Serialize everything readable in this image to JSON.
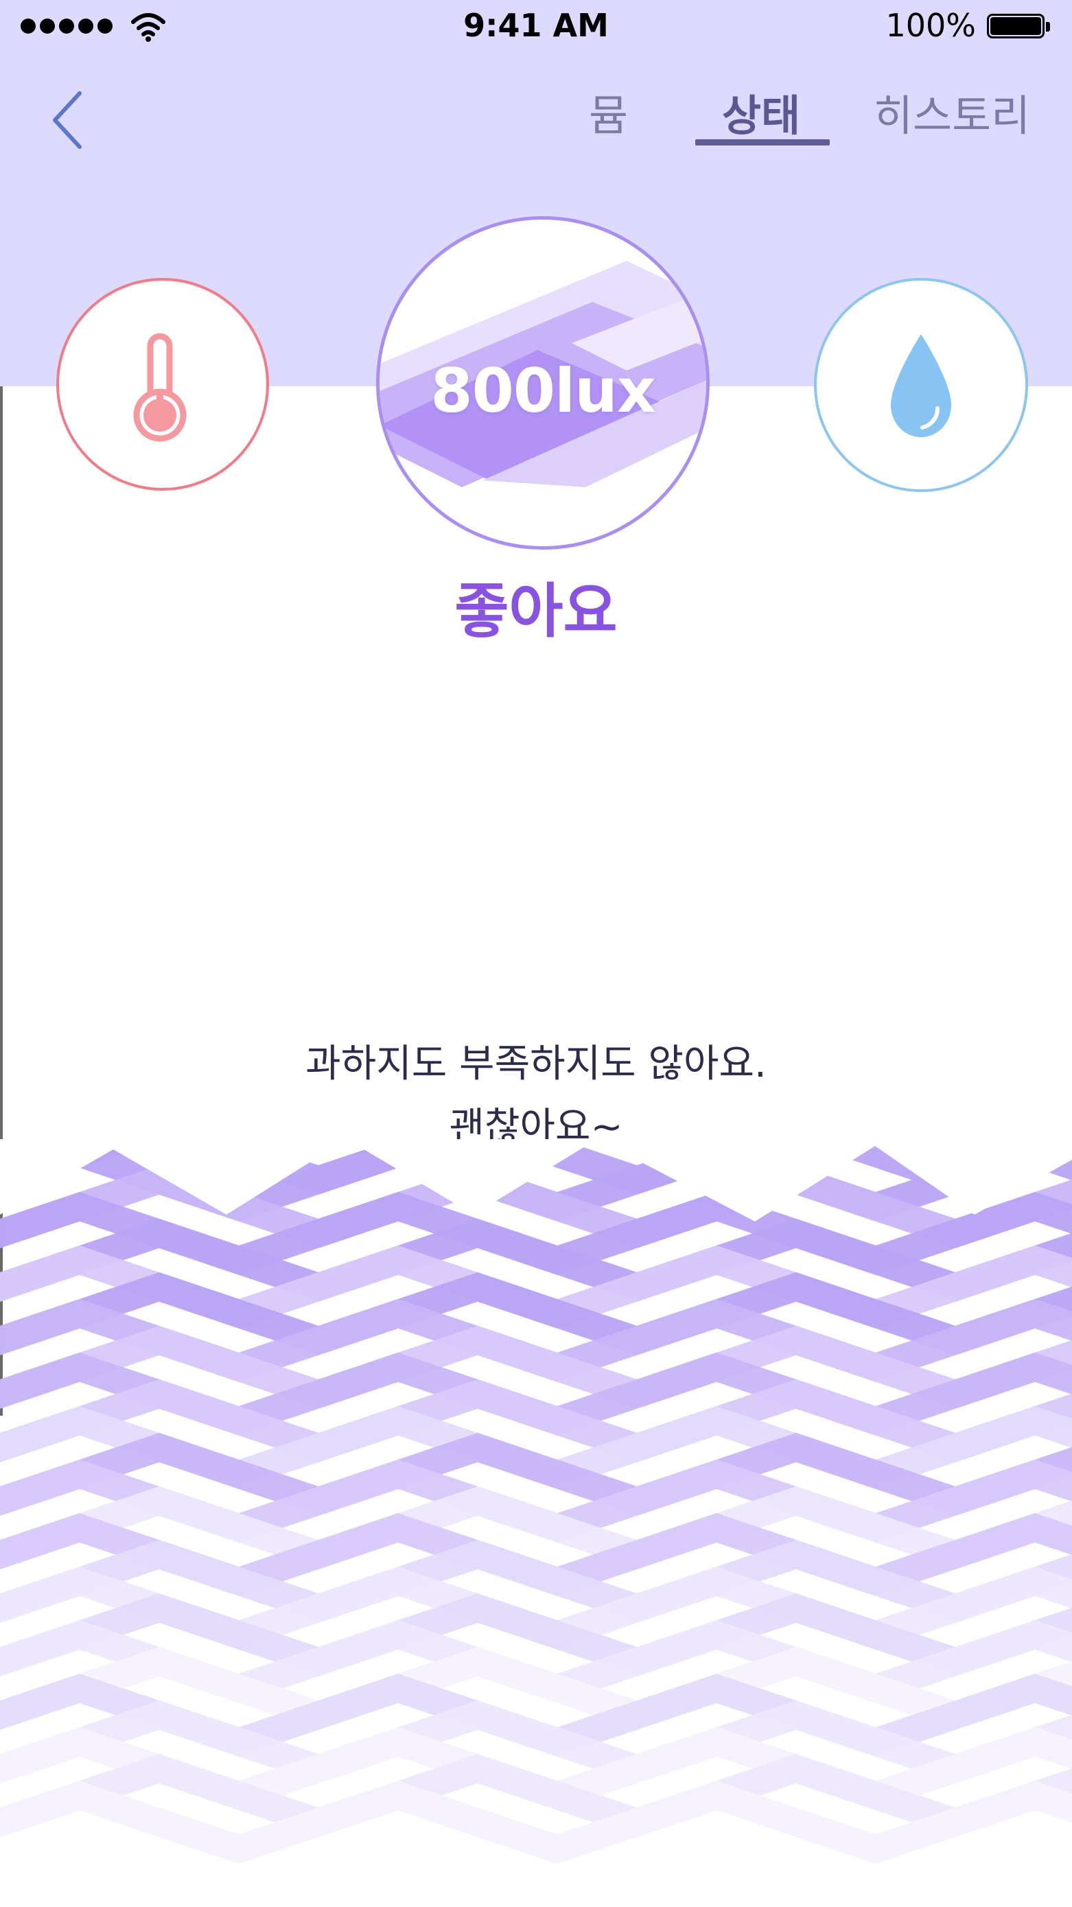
{
  "status_bar": {
    "time": "9:41 AM",
    "battery": "100%"
  },
  "nav": {
    "tabs": [
      {
        "label": "뮴",
        "active": false
      },
      {
        "label": "상태",
        "active": true
      },
      {
        "label": "히스토리",
        "active": false
      }
    ]
  },
  "sensors": {
    "temperature": {
      "icon": "thermometer-icon",
      "color": "#ef7c87"
    },
    "light": {
      "value": "800lux",
      "color": "#a98ff1"
    },
    "humidity": {
      "icon": "water-drop-icon",
      "color": "#8cc6ef"
    }
  },
  "status": {
    "label": "좋아요",
    "description_line1": "과하지도 부족하지도 않아요.",
    "description_line2": "괜찮아요~"
  },
  "colors": {
    "header_background": "#dedafe",
    "accent": "#8753e0",
    "text_dark": "#2d2b4b"
  }
}
